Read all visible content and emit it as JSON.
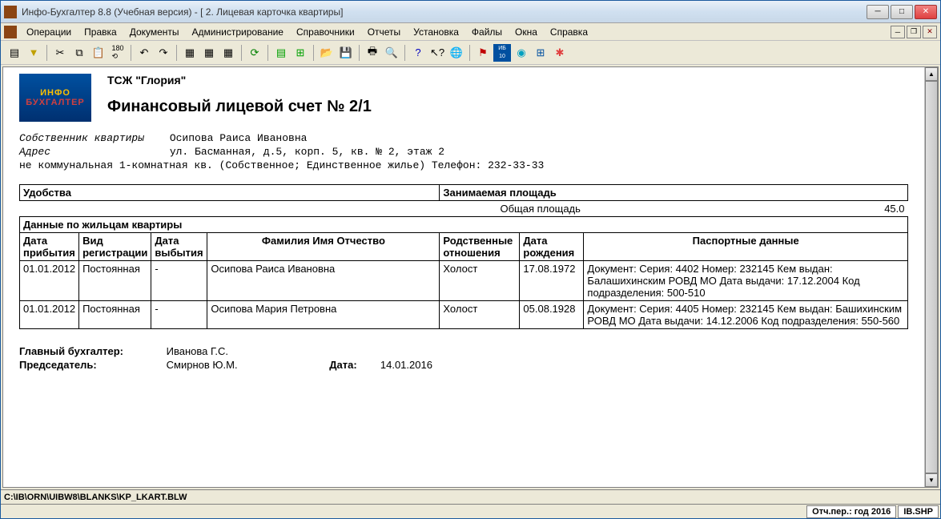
{
  "window": {
    "title": "Инфо-Бухгалтер 8.8 (Учебная версия) - [   2. Лицевая карточка квартиры]"
  },
  "menu": {
    "items": [
      "Операции",
      "Правка",
      "Документы",
      "Администрирование",
      "Справочники",
      "Отчеты",
      "Установка",
      "Файлы",
      "Окна",
      "Справка"
    ]
  },
  "document": {
    "logo_line1": "ИНФО",
    "logo_line2": "БУХГАЛТЕР",
    "org_name": "ТСЖ \"Глория\"",
    "title": "Финансовый лицевой счет № 2/1",
    "owner_label": "Собственник квартиры",
    "owner_value": "Осипова Раиса Ивановна",
    "address_label": "Адрес",
    "address_value": "ул. Басманная, д.5, корп. 5, кв. № 2, этаж 2",
    "apt_line": "не коммунальная 1-комнатная кв. (Собственное; Единственное жилье)   Телефон: 232-33-33",
    "amenities_header": "Удобства",
    "area_header": "Занимаемая площадь",
    "total_area_label": "Общая площадь",
    "total_area_value": "45.0",
    "residents_header": "Данные по жильцам квартиры",
    "cols": {
      "arrival": "Дата прибытия",
      "regtype": "Вид регистрации",
      "departure": "Дата выбытия",
      "fio": "Фамилия Имя Отчество",
      "relation": "Родственные отношения",
      "birth": "Дата рождения",
      "passport": "Паспортные данные"
    },
    "rows": [
      {
        "arrival": "01.01.2012",
        "regtype": "Постоянная",
        "departure": "-",
        "fio": "Осипова Раиса Ивановна",
        "relation": "Холост",
        "birth": "17.08.1972",
        "passport": "Документ:  Серия: 4402 Номер: 232145 Кем выдан: Балашихинским РОВД МО Дата выдачи: 17.12.2004 Код подразделения: 500-510"
      },
      {
        "arrival": "01.01.2012",
        "regtype": "Постоянная",
        "departure": "-",
        "fio": "Осипова Мария Петровна",
        "relation": "Холост",
        "birth": "05.08.1928",
        "passport": "Документ:  Серия: 4405 Номер: 232145 Кем выдан: Башихинским РОВД МО Дата выдачи: 14.12.2006 Код подразделения: 550-560"
      }
    ],
    "accountant_label": "Главный бухгалтер:",
    "accountant_value": "Иванова Г.С.",
    "chairman_label": "Председатель:",
    "chairman_value": "Смирнов Ю.М.",
    "date_label": "Дата:",
    "date_value": "14.01.2016"
  },
  "status": {
    "path": "C:\\IB\\ORN\\UIBW8\\BLANKS\\KP_LKART.BLW",
    "period": "Отч.пер.: год 2016",
    "file": "IB.SHP"
  }
}
